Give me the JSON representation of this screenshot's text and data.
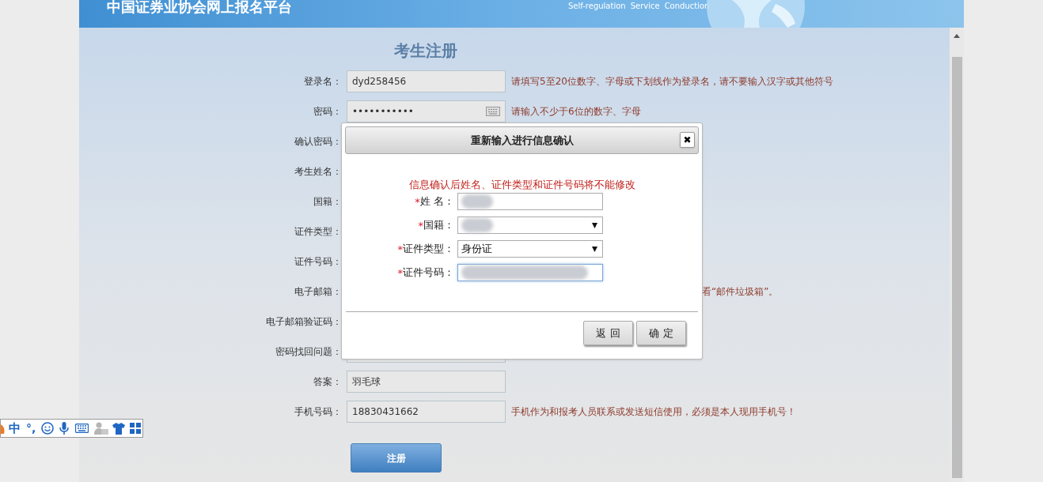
{
  "header": {
    "title": "中国证券业协会网上报名平台",
    "nav": [
      "Self-regulation",
      "Service",
      "Conduction"
    ]
  },
  "page_title": "考生注册",
  "form": {
    "rows": [
      {
        "label": "登录名：",
        "kind": "text",
        "value": "dyd258456",
        "hint": "请填写5至20位数字、字母或下划线作为登录名，请不要输入汉字或其他符号"
      },
      {
        "label": "密码：",
        "kind": "password",
        "value": "•••••••••••",
        "hint": "请输入不少于6位的数字、字母"
      },
      {
        "label": "确认密码：",
        "kind": "label_only"
      },
      {
        "label": "考生姓名：",
        "kind": "label_only"
      },
      {
        "label": "国籍：",
        "kind": "label_only"
      },
      {
        "label": "证件类型：",
        "kind": "label_only"
      },
      {
        "label": "证件号码：",
        "kind": "label_only"
      },
      {
        "label": "电子邮箱：",
        "kind": "label_only",
        "hint_tail": "看“邮件垃圾箱”。"
      },
      {
        "label": "电子邮箱验证码：",
        "kind": "label_only"
      },
      {
        "label": "密码找回问题：",
        "kind": "text"
      },
      {
        "label": "答案：",
        "kind": "text",
        "value": "羽毛球"
      },
      {
        "label": "手机号码：",
        "kind": "text",
        "value": "18830431662",
        "hint": "手机作为和报考人员联系或发送短信使用，必须是本人现用手机号！"
      }
    ]
  },
  "submit_button": "注册",
  "dialog": {
    "title": "重新输入进行信息确认",
    "close": "✖",
    "warning": "信息确认后姓名、证件类型和证件号码将不能修改",
    "fields": [
      {
        "label": "姓 名：",
        "kind": "text",
        "required_mark": "*",
        "redacted": true,
        "focused": false
      },
      {
        "label": "国籍：",
        "kind": "select",
        "required_mark": "*",
        "redacted": true,
        "focused": false
      },
      {
        "label": "证件类型：",
        "kind": "select",
        "required_mark": "*",
        "value": "身份证",
        "redacted": false,
        "focused": false
      },
      {
        "label": "证件号码：",
        "kind": "text",
        "required_mark": "*",
        "redacted": true,
        "focused": true
      }
    ],
    "buttons": [
      "返 回",
      "确 定"
    ]
  },
  "ime_toolbar": {
    "mode": "中",
    "punctuation": "°,"
  }
}
